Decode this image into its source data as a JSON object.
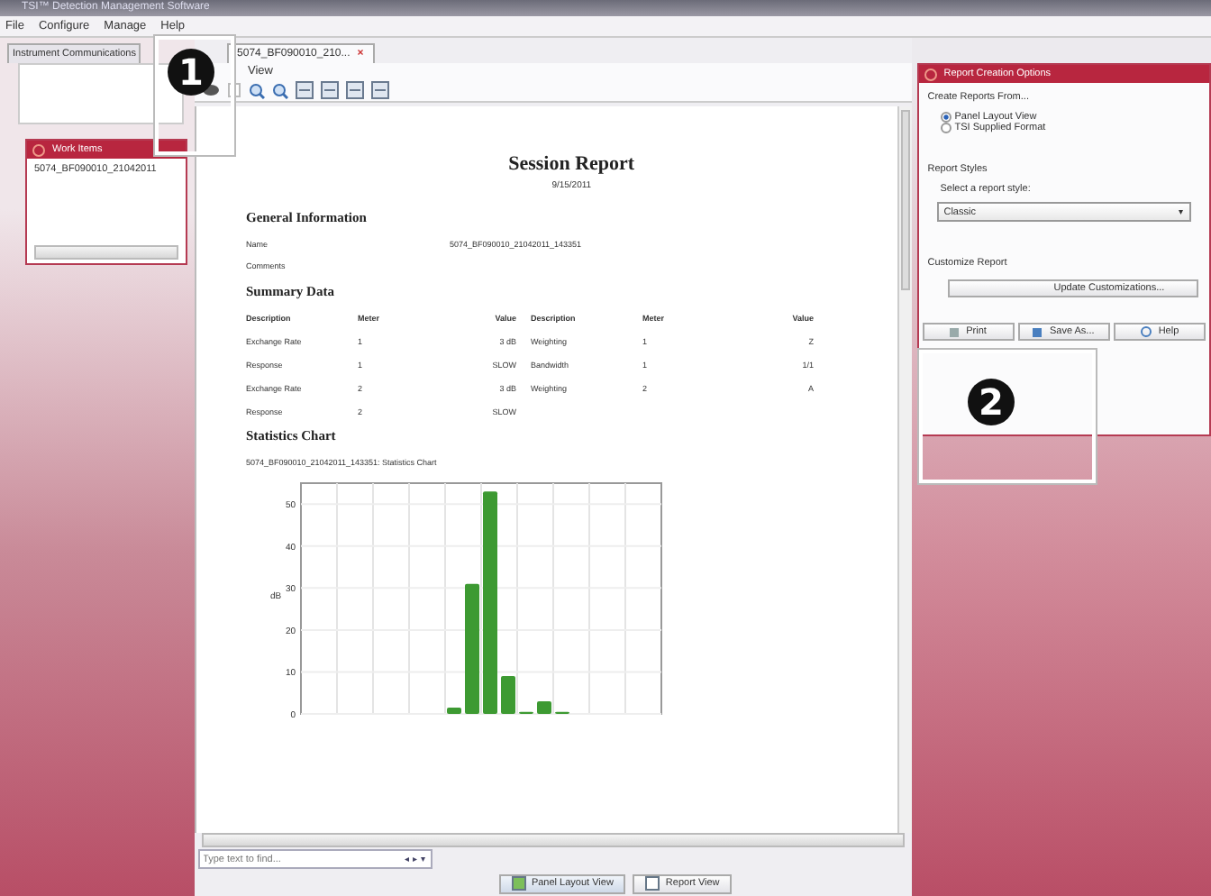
{
  "window": {
    "title": "TSI™ Detection Management Software"
  },
  "menu": [
    "File",
    "Configure",
    "Manage",
    "Help"
  ],
  "left_tabs": [
    {
      "label": "Instrument Communications",
      "selected": false
    }
  ],
  "work_items": {
    "title": "Work Items",
    "items": [
      "5074_BF090010_21042011"
    ]
  },
  "document_tabs": [
    {
      "label": "5074_BF090010_210...",
      "selected": true,
      "close": "×"
    }
  ],
  "document_menu": [
    "View"
  ],
  "report": {
    "title": "Session Report",
    "date": "9/15/2011",
    "general": {
      "heading": "General Information",
      "rows": [
        {
          "label": "Name",
          "value": "5074_BF090010_21042011_143351"
        },
        {
          "label": "Comments"
        }
      ]
    },
    "summary": {
      "heading": "Summary Data",
      "columns": [
        "Description",
        "Meter",
        "Value",
        "Description",
        "Meter",
        "Value"
      ],
      "rows": [
        [
          "Exchange Rate",
          "1",
          "3 dB",
          "Weighting",
          "1",
          "Z"
        ],
        [
          "Response",
          "1",
          "SLOW",
          "Bandwidth",
          "1",
          "1/1"
        ],
        [
          "Exchange Rate",
          "2",
          "3 dB",
          "Weighting",
          "2",
          "A"
        ],
        [
          "Response",
          "2",
          "SLOW"
        ]
      ]
    },
    "statistics": {
      "heading": "Statistics Chart",
      "caption": "5074_BF090010_21042011_143351: Statistics Chart",
      "chart_data": {
        "type": "bar",
        "grid": true,
        "ylabel": "dB",
        "ylim": [
          0,
          55
        ],
        "yticks": [
          0,
          10,
          20,
          30,
          40,
          50
        ],
        "values": [
          0,
          0,
          0,
          0,
          0,
          0,
          0,
          0,
          1.5,
          31,
          53,
          9,
          0.5,
          3,
          0.5,
          0,
          0,
          0,
          0,
          0
        ]
      }
    }
  },
  "find": {
    "placeholder": "Type text to find...",
    "nav": "◂ ▸ ▾"
  },
  "view_buttons": [
    {
      "label": "Panel Layout View",
      "selected": true
    },
    {
      "label": "Report View",
      "selected": false
    }
  ],
  "options": {
    "title": "Report Creation Options",
    "create_label": "Create Reports From...",
    "sources": [
      {
        "label": "Panel Layout View",
        "selected": true
      },
      {
        "label": "TSI Supplied Format",
        "selected": false
      }
    ],
    "styles_label": "Report Styles",
    "style_prompt": "Select a report style:",
    "style_value": "Classic",
    "style_caret": "▾",
    "customize_label": "Customize Report",
    "customize_button": "Update Customizations...",
    "buttons": [
      "Print",
      "Save As...",
      "Help"
    ]
  },
  "callouts": [
    {
      "number": "1"
    },
    {
      "number": "2"
    }
  ]
}
